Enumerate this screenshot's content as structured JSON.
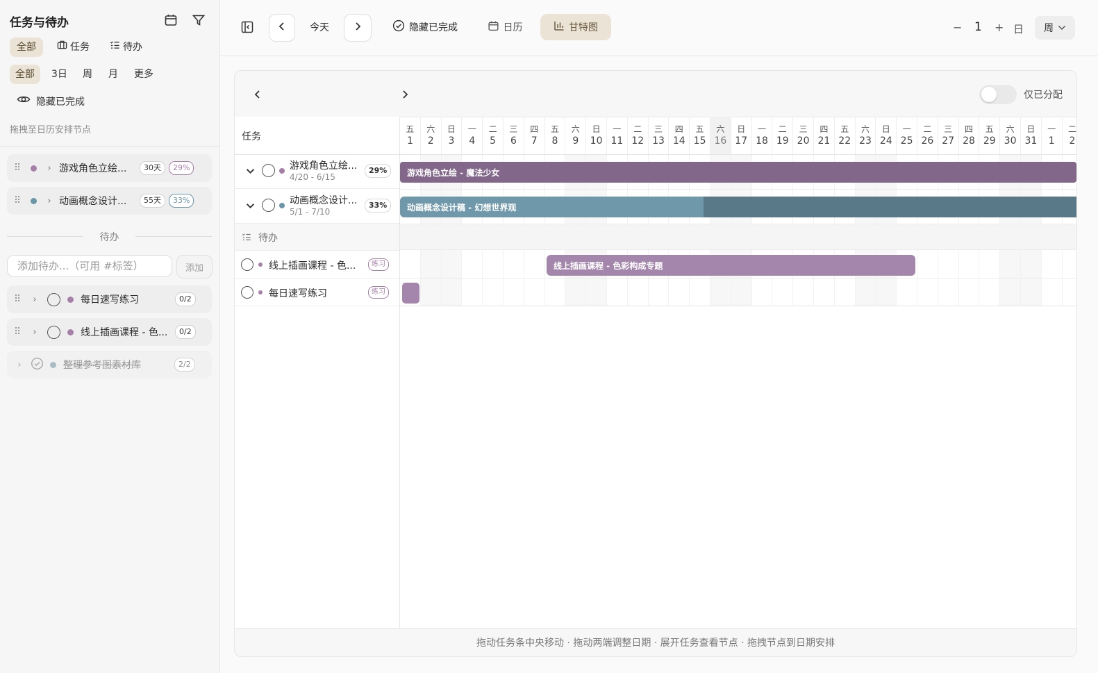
{
  "sidebar": {
    "title": "任务与待办",
    "type_filters": [
      "全部",
      "任务",
      "待办"
    ],
    "range_filters": [
      "全部",
      "3日",
      "周",
      "月",
      "更多"
    ],
    "hide_done": "隐藏已完成",
    "hint": "拖拽至日历安排节点",
    "tasks": [
      {
        "label": "游戏角色立绘...",
        "days": "30天",
        "pct": "29%",
        "color": "#a67fa9"
      },
      {
        "label": "动画概念设计...",
        "days": "55天",
        "pct": "33%",
        "color": "#6b96a9"
      }
    ],
    "todo_section": "待办",
    "todo_placeholder": "添加待办...（可用 #标签）",
    "add_label": "添加",
    "todos": [
      {
        "label": "每日速写练习",
        "count": "0/2",
        "color": "#a67fa9"
      },
      {
        "label": "线上插画课程 - 色...",
        "count": "0/2",
        "color": "#a67fa9"
      },
      {
        "label": "整理参考图素材库",
        "count": "2/2",
        "color": "#a9bcc4"
      }
    ]
  },
  "toolbar": {
    "today": "今天",
    "hide_done": "隐藏已完成",
    "calendar": "日历",
    "gantt": "甘特图",
    "minus": "−",
    "zoom_value": "1",
    "plus": "+",
    "unit": "日",
    "scale": "周"
  },
  "gantt": {
    "assigned_only": "仅已分配",
    "col_header": "任务",
    "days": [
      {
        "wd": "五",
        "d": "1"
      },
      {
        "wd": "六",
        "d": "2"
      },
      {
        "wd": "日",
        "d": "3"
      },
      {
        "wd": "一",
        "d": "4"
      },
      {
        "wd": "二",
        "d": "5"
      },
      {
        "wd": "三",
        "d": "6"
      },
      {
        "wd": "四",
        "d": "7"
      },
      {
        "wd": "五",
        "d": "8"
      },
      {
        "wd": "六",
        "d": "9"
      },
      {
        "wd": "日",
        "d": "10"
      },
      {
        "wd": "一",
        "d": "11"
      },
      {
        "wd": "二",
        "d": "12"
      },
      {
        "wd": "三",
        "d": "13"
      },
      {
        "wd": "四",
        "d": "14"
      },
      {
        "wd": "五",
        "d": "15"
      },
      {
        "wd": "六",
        "d": "16"
      },
      {
        "wd": "日",
        "d": "17"
      },
      {
        "wd": "一",
        "d": "18"
      },
      {
        "wd": "二",
        "d": "19"
      },
      {
        "wd": "三",
        "d": "20"
      },
      {
        "wd": "四",
        "d": "21"
      },
      {
        "wd": "五",
        "d": "22"
      },
      {
        "wd": "六",
        "d": "23"
      },
      {
        "wd": "日",
        "d": "24"
      },
      {
        "wd": "一",
        "d": "25"
      },
      {
        "wd": "二",
        "d": "26"
      },
      {
        "wd": "三",
        "d": "27"
      },
      {
        "wd": "四",
        "d": "28"
      },
      {
        "wd": "五",
        "d": "29"
      },
      {
        "wd": "六",
        "d": "30"
      },
      {
        "wd": "日",
        "d": "31"
      },
      {
        "wd": "一",
        "d": "1"
      },
      {
        "wd": "二",
        "d": "2"
      }
    ],
    "tasks": [
      {
        "title": "游戏角色立绘...",
        "dates": "4/20 - 6/15",
        "pct": "29%",
        "bar": "游戏角色立绘 - 魔法少女"
      },
      {
        "title": "动画概念设计...",
        "dates": "5/1 - 7/10",
        "pct": "33%",
        "bar": "动画概念设计稿 - 幻想世界观"
      }
    ],
    "todo_group": "待办",
    "todos": [
      {
        "title": "线上插画课程 - 色...",
        "tag": "练习",
        "bar": "线上插画课程 - 色彩构成专题"
      },
      {
        "title": "每日速写练习",
        "tag": "练习"
      }
    ],
    "footer": "拖动任务条中央移动 · 拖动两端调整日期 · 展开任务查看节点 · 拖拽节点到日期安排"
  }
}
